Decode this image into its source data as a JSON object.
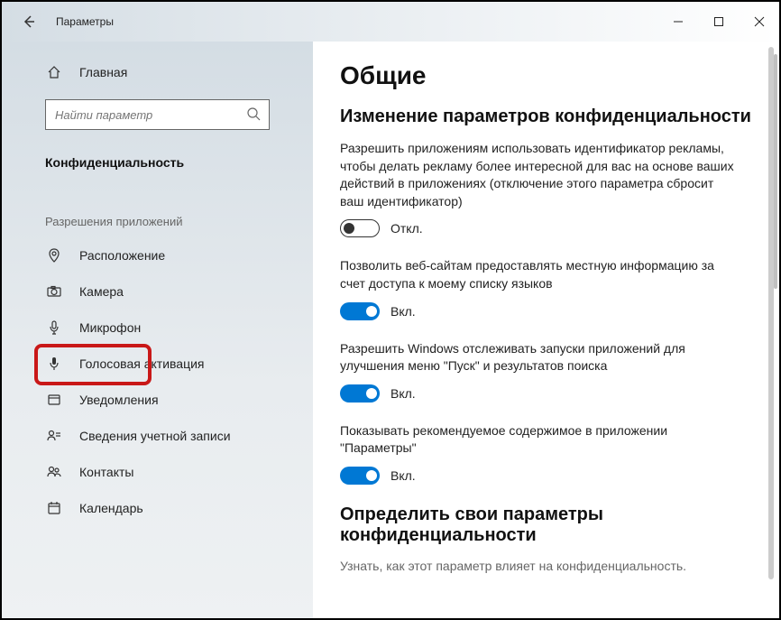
{
  "window": {
    "title": "Параметры"
  },
  "sidebar": {
    "home": "Главная",
    "search_placeholder": "Найти параметр",
    "section": "Конфиденциальность",
    "subsection": "Разрешения приложений",
    "items": [
      {
        "label": "Расположение"
      },
      {
        "label": "Камера"
      },
      {
        "label": "Микрофон"
      },
      {
        "label": "Голосовая активация"
      },
      {
        "label": "Уведомления"
      },
      {
        "label": "Сведения учетной записи"
      },
      {
        "label": "Контакты"
      },
      {
        "label": "Календарь"
      }
    ]
  },
  "main": {
    "heading": "Общие",
    "subheading": "Изменение параметров конфиденциальности",
    "settings": [
      {
        "desc": "Разрешить приложениям использовать идентификатор рекламы, чтобы делать рекламу более интересной для вас на основе ваших действий в приложениях (отключение этого параметра сбросит ваш идентификатор)",
        "state": "Откл.",
        "on": false
      },
      {
        "desc": "Позволить веб-сайтам предоставлять местную информацию за счет доступа к моему списку языков",
        "state": "Вкл.",
        "on": true
      },
      {
        "desc": "Разрешить Windows отслеживать запуски приложений для улучшения меню \"Пуск\" и результатов поиска",
        "state": "Вкл.",
        "on": true
      },
      {
        "desc": "Показывать рекомендуемое содержимое в приложении \"Параметры\"",
        "state": "Вкл.",
        "on": true
      }
    ],
    "section2_heading": "Определить свои параметры конфиденциальности",
    "section2_note": "Узнать, как этот параметр влияет на конфиденциальность."
  }
}
